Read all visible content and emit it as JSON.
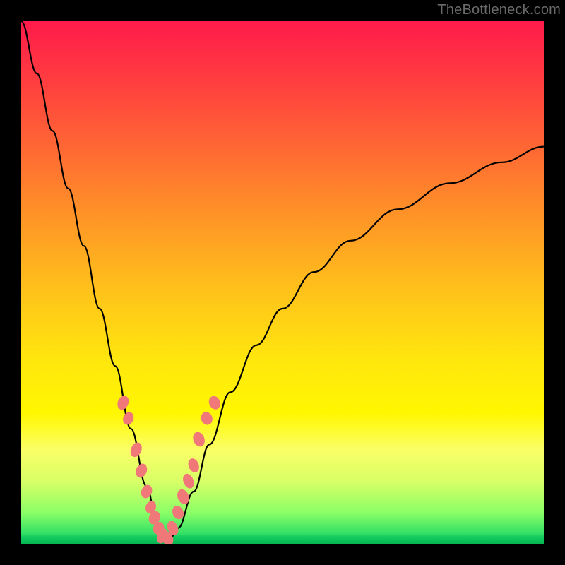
{
  "watermark": "TheBottleneck.com",
  "colors": {
    "gradient_top": "#ff1a4a",
    "gradient_bottom": "#0fc45a",
    "curve": "#000000",
    "beads": "#f07878",
    "frame": "#000000"
  },
  "chart_data": {
    "type": "line",
    "title": "",
    "xlabel": "",
    "ylabel": "",
    "xlim": [
      0,
      100
    ],
    "ylim": [
      0,
      100
    ],
    "grid": false,
    "legend": false,
    "annotations": [
      "TheBottleneck.com"
    ],
    "series": [
      {
        "name": "bottleneck-curve",
        "x": [
          0,
          3,
          6,
          9,
          12,
          15,
          18,
          21,
          24,
          26,
          28,
          30,
          33,
          36,
          40,
          45,
          50,
          56,
          63,
          72,
          82,
          92,
          100
        ],
        "y": [
          100,
          90,
          79,
          68,
          57,
          45,
          34,
          22,
          11,
          4,
          0,
          3,
          10,
          19,
          29,
          38,
          45,
          52,
          58,
          64,
          69,
          73,
          76
        ],
        "note": "Approximate V-shaped curve. y is percent height from bottom (0=green bottom, 100=top). Minimum (bottleneck point) near x≈28."
      }
    ],
    "markers": [
      {
        "name": "beads-left-arm",
        "x": [
          19.5,
          20.5,
          22.0,
          23.0,
          24.0,
          24.8,
          25.5,
          26.3,
          27.0
        ],
        "y": [
          27.0,
          24.0,
          18.0,
          14.0,
          10.0,
          7.0,
          5.0,
          3.0,
          1.5
        ],
        "note": "Pink bead cluster scattered along lower-left arm of the V."
      },
      {
        "name": "beads-right-arm",
        "x": [
          28.0,
          29.0,
          30.0,
          31.0,
          32.0,
          33.0,
          34.0,
          35.5,
          37.0
        ],
        "y": [
          1.0,
          3.0,
          6.0,
          9.0,
          12.0,
          15.0,
          20.0,
          24.0,
          27.0
        ],
        "note": "Pink bead cluster scattered along lower-right arm of the V."
      }
    ]
  }
}
